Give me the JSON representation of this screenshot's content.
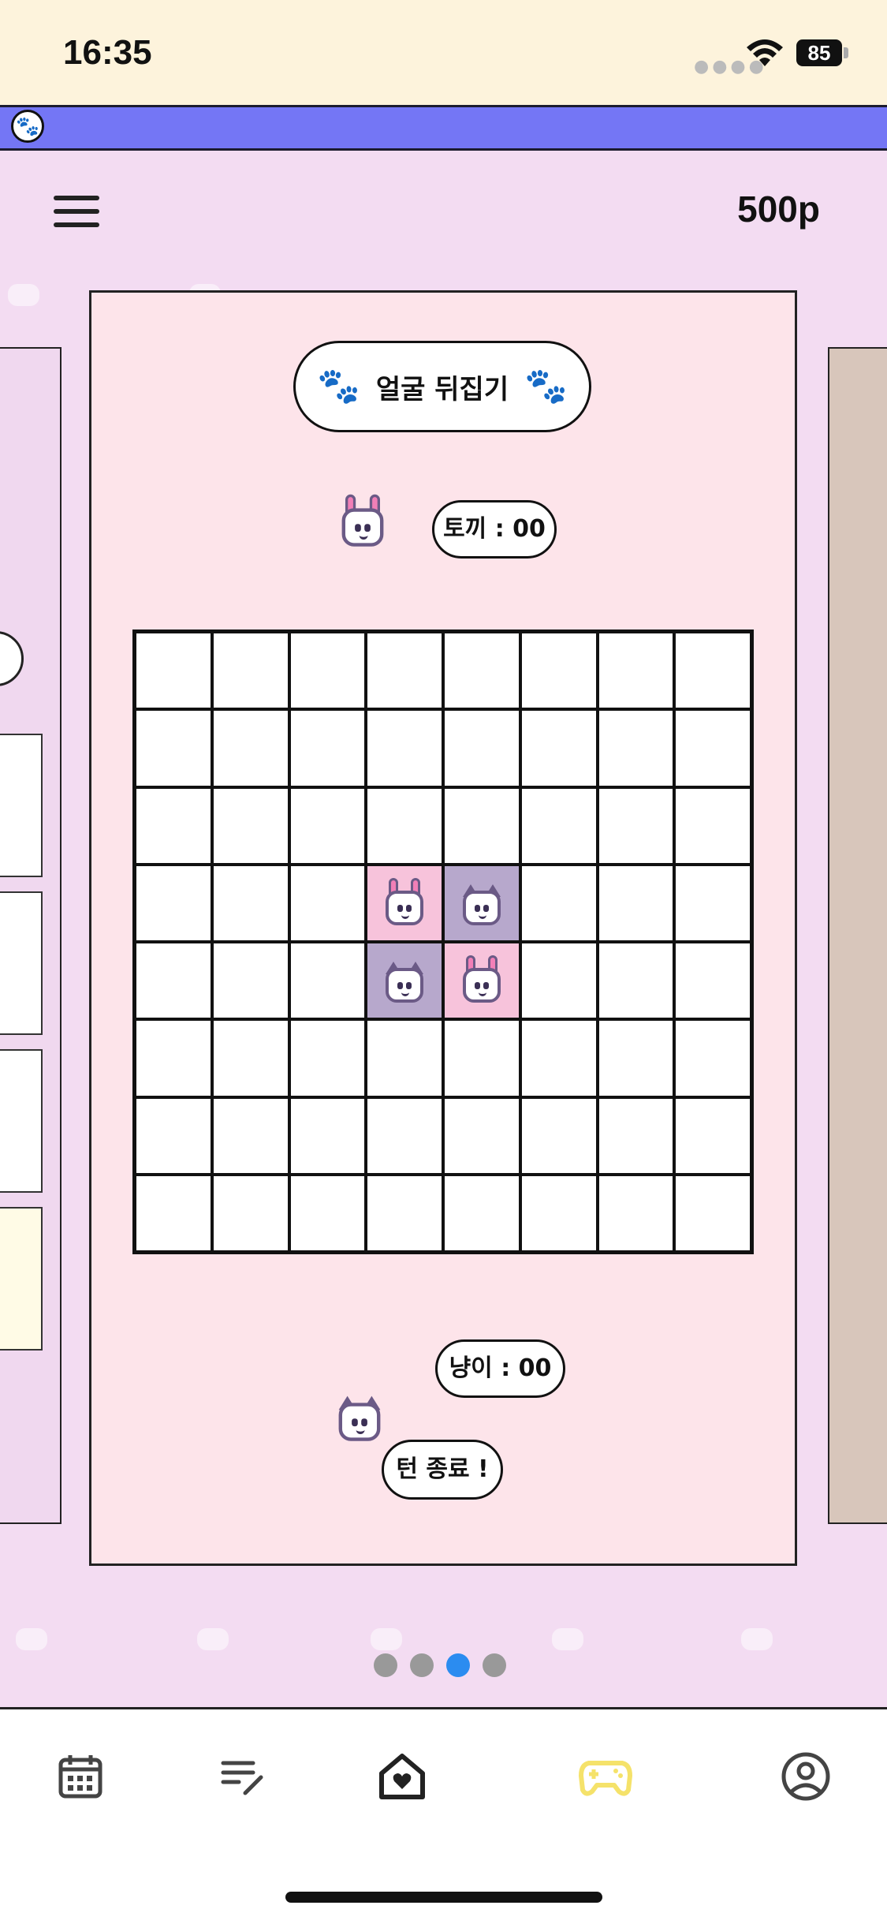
{
  "status_bar": {
    "time": "16:35",
    "battery": "85"
  },
  "header": {
    "points": "500p"
  },
  "game": {
    "title": "얼굴 뒤집기",
    "rabbit_score": "토끼 : 00",
    "cat_score": "냥이 : 00",
    "end_turn": "턴 종료 !",
    "board": [
      [
        "",
        "",
        "",
        "",
        "",
        "",
        "",
        ""
      ],
      [
        "",
        "",
        "",
        "",
        "",
        "",
        "",
        ""
      ],
      [
        "",
        "",
        "",
        "",
        "",
        "",
        "",
        ""
      ],
      [
        "",
        "",
        "",
        "rabbit",
        "cat",
        "",
        "",
        ""
      ],
      [
        "",
        "",
        "",
        "cat",
        "rabbit",
        "",
        "",
        ""
      ],
      [
        "",
        "",
        "",
        "",
        "",
        "",
        "",
        ""
      ],
      [
        "",
        "",
        "",
        "",
        "",
        "",
        "",
        ""
      ],
      [
        "",
        "",
        "",
        "",
        "",
        "",
        "",
        ""
      ]
    ]
  },
  "carousel": {
    "pages": 4,
    "active_index": 2
  },
  "tabbar": {
    "items": [
      {
        "icon": "calendar-icon"
      },
      {
        "icon": "edit-list-icon"
      },
      {
        "icon": "home-heart-icon"
      },
      {
        "icon": "gamepad-icon",
        "active": true
      },
      {
        "icon": "profile-icon"
      }
    ],
    "active_color": "#f5e26a"
  },
  "colors": {
    "status_bg": "#fdf3dc",
    "banner": "#7476f5",
    "page_bg": "#f3dcf2",
    "card_bg": "#fde4ea",
    "rabbit_cell": "#f7c3db",
    "cat_cell": "#b7a8cc"
  }
}
